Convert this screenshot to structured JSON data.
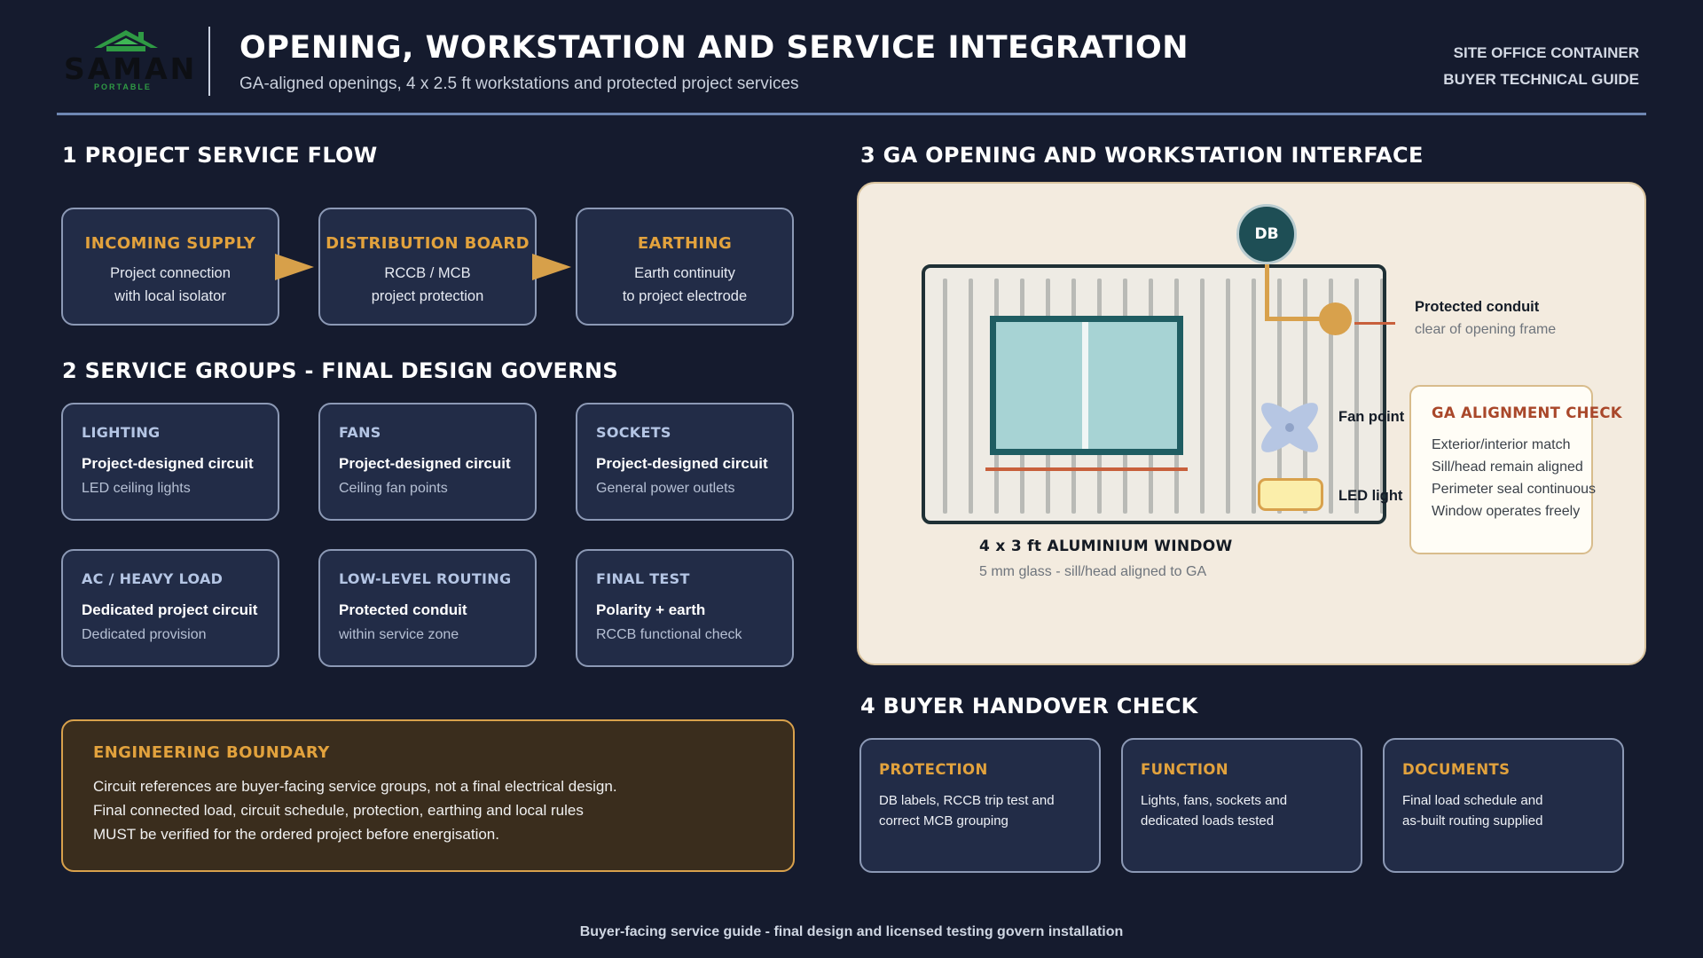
{
  "header": {
    "logo_word": "SAMAN",
    "logo_sub": "PORTABLE",
    "title": "OPENING, WORKSTATION AND SERVICE INTEGRATION",
    "subtitle": "GA-aligned openings, 4 x 2.5 ft workstations and protected project services",
    "tag_line_1": "SITE OFFICE CONTAINER",
    "tag_line_2": "BUYER TECHNICAL GUIDE"
  },
  "section1": {
    "title": "1 PROJECT SERVICE FLOW",
    "boxes": [
      {
        "title": "INCOMING SUPPLY",
        "line1": "Project connection",
        "line2": "with local isolator"
      },
      {
        "title": "DISTRIBUTION BOARD",
        "line1": "RCCB / MCB",
        "line2": "project protection"
      },
      {
        "title": "EARTHING",
        "line1": "Earth continuity",
        "line2": "to project electrode"
      }
    ]
  },
  "section2": {
    "title": "2 SERVICE GROUPS - FINAL DESIGN GOVERNS",
    "cards": [
      {
        "title": "LIGHTING",
        "bold": "Project-designed circuit",
        "light": "LED ceiling lights"
      },
      {
        "title": "FANS",
        "bold": "Project-designed circuit",
        "light": "Ceiling fan points"
      },
      {
        "title": "SOCKETS",
        "bold": "Project-designed circuit",
        "light": "General power outlets"
      },
      {
        "title": "AC / HEAVY LOAD",
        "bold": "Dedicated project circuit",
        "light": "Dedicated provision"
      },
      {
        "title": "LOW-LEVEL ROUTING",
        "bold": "Protected conduit",
        "light": "within service zone"
      },
      {
        "title": "FINAL TEST",
        "bold": "Polarity + earth",
        "light": "RCCB functional check"
      }
    ]
  },
  "boundary": {
    "title": "ENGINEERING BOUNDARY",
    "line1": "Circuit references are buyer-facing service groups, not a final electrical design.",
    "line2": "Final connected load, circuit schedule, protection, earthing and local rules",
    "line3": "MUST be verified for the ordered project before energisation."
  },
  "section3": {
    "title": "3 GA OPENING AND WORKSTATION INTERFACE",
    "db_label": "DB",
    "conduit_title": "Protected conduit",
    "conduit_sub": "clear of opening frame",
    "fan_label": "Fan point",
    "led_label": "LED light",
    "window_title": "4 x 3 ft ALUMINIUM WINDOW",
    "window_sub": "5 mm glass - sill/head aligned to GA",
    "check": {
      "title": "GA ALIGNMENT CHECK",
      "items": [
        "Exterior/interior match",
        "Sill/head remain aligned",
        "Perimeter seal continuous",
        "Window operates freely"
      ]
    }
  },
  "section4": {
    "title": "4 BUYER HANDOVER CHECK",
    "cards": [
      {
        "title": "PROTECTION",
        "line1": "DB labels, RCCB trip test and",
        "line2": "correct MCB grouping"
      },
      {
        "title": "FUNCTION",
        "line1": "Lights, fans, sockets and",
        "line2": "dedicated loads tested"
      },
      {
        "title": "DOCUMENTS",
        "line1": "Final load schedule and",
        "line2": "as-built routing supplied"
      }
    ]
  },
  "footer": "Buyer-facing service guide - final design and licensed testing govern installation",
  "colors": {
    "background": "#151b2e",
    "card": "#222c47",
    "accent_gold": "#e2a23d",
    "accent_blue": "#b4c5e4",
    "panel_cream": "#f3ebdf",
    "window_glass": "#a7d3d4",
    "db_teal": "#1e4e55"
  },
  "icons": [
    "house-logo-icon",
    "flow-arrow-icon",
    "fan-icon",
    "led-light-icon",
    "db-icon"
  ]
}
